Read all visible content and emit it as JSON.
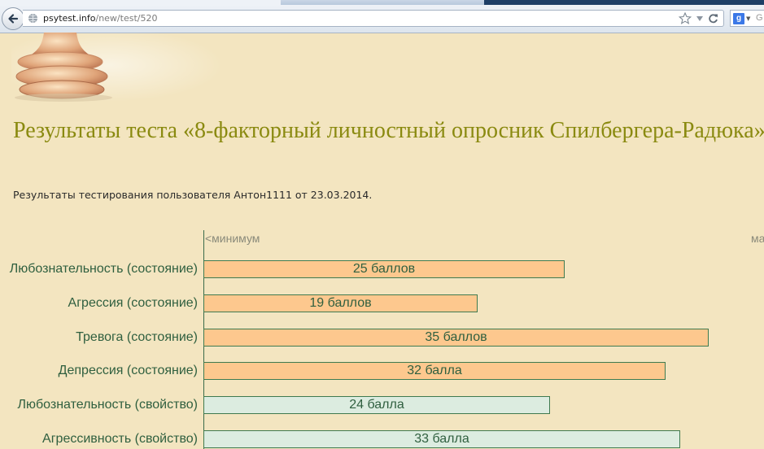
{
  "browser": {
    "url_host": "psytest.info",
    "url_path": "/new/test/520",
    "search_hint": "G"
  },
  "page": {
    "title": "Результаты теста «8-факторный личностный опросник Спилбергера-Радюка»",
    "subtitle": "Результаты тестирования пользователя Антон1111 от 23.03.2014."
  },
  "chart_data": {
    "type": "bar",
    "orientation": "horizontal",
    "scale_min_label": "<минимум",
    "scale_max_label": "ма",
    "bar_max": 40,
    "colors": {
      "state": "#fdc88e",
      "trait": "#dcece0",
      "border": "#3f7a4f",
      "text": "#2f5f3f"
    },
    "rows": [
      {
        "label": "Любознательность (состояние)",
        "value": 25,
        "value_label": "25 баллов",
        "kind": "state"
      },
      {
        "label": "Агрессия (состояние)",
        "value": 19,
        "value_label": "19 баллов",
        "kind": "state"
      },
      {
        "label": "Тревога (состояние)",
        "value": 35,
        "value_label": "35 баллов",
        "kind": "state"
      },
      {
        "label": "Депрессия (состояние)",
        "value": 32,
        "value_label": "32 балла",
        "kind": "state"
      },
      {
        "label": "Любознательность (свойство)",
        "value": 24,
        "value_label": "24 балла",
        "kind": "trait"
      },
      {
        "label": "Агрессивность (свойство)",
        "value": 33,
        "value_label": "33 балла",
        "kind": "trait"
      }
    ]
  }
}
